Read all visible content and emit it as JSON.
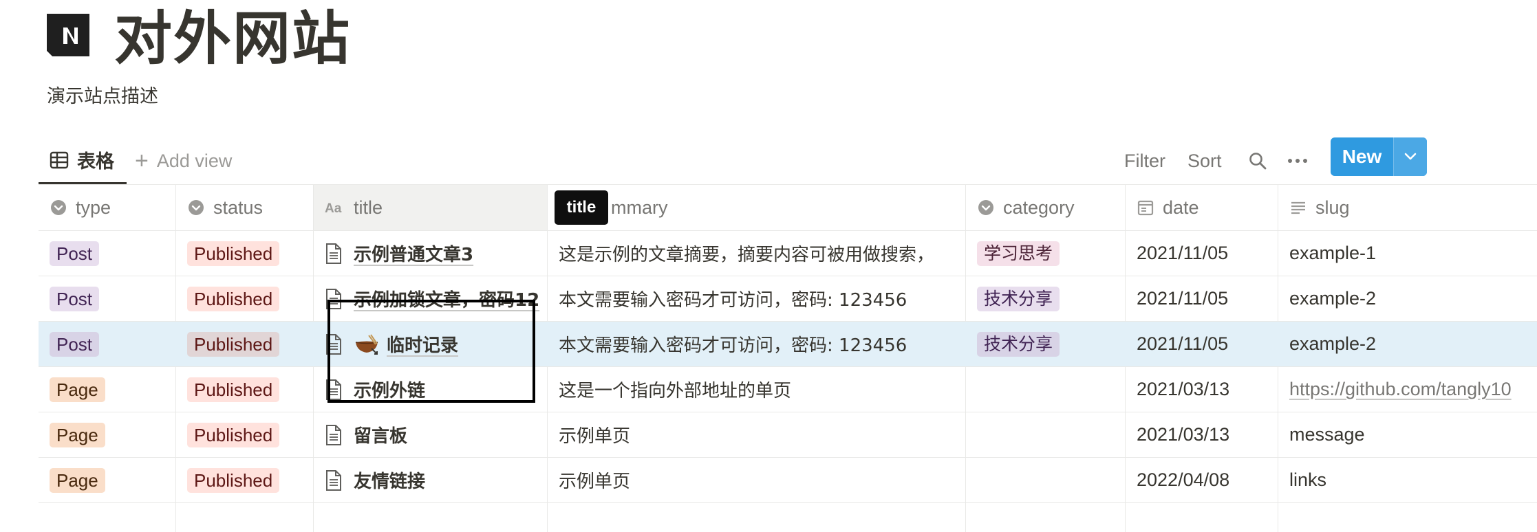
{
  "page": {
    "title": "对外网站",
    "description": "演示站点描述",
    "icon": "notion-logo-icon"
  },
  "view_bar": {
    "active_view": "表格",
    "add_view": "Add view",
    "filter": "Filter",
    "sort": "Sort",
    "new": "New"
  },
  "columns": {
    "type": "type",
    "status": "status",
    "title": "title",
    "summary": "mmary",
    "category": "category",
    "date": "date",
    "slug": "slug"
  },
  "tooltip": "title",
  "rows": [
    {
      "type": "Post",
      "status": "Published",
      "title": "示例普通文章3",
      "summary": "这是示例的文章摘要，摘要内容可被用做搜索，",
      "category": "学习思考",
      "date": "2021/11/05",
      "slug": "example-1"
    },
    {
      "type": "Post",
      "status": "Published",
      "title": "示例加锁文章，密码12",
      "summary": "本文需要输入密码才可访问，密码: 123456",
      "category": "技术分享",
      "date": "2021/11/05",
      "slug": "example-2"
    },
    {
      "type": "Post",
      "status": "Published",
      "title": "临时记录",
      "summary": "本文需要输入密码才可访问，密码: 123456",
      "category": "技术分享",
      "date": "2021/11/05",
      "slug": "example-2"
    },
    {
      "type": "Page",
      "status": "Published",
      "title": "示例外链",
      "summary": "这是一个指向外部地址的单页",
      "category": "",
      "date": "2021/03/13",
      "slug": "https://github.com/tangly10"
    },
    {
      "type": "Page",
      "status": "Published",
      "title": "留言板",
      "summary": "示例单页",
      "category": "",
      "date": "2021/03/13",
      "slug": "message"
    },
    {
      "type": "Page",
      "status": "Published",
      "title": "友情链接",
      "summary": "示例单页",
      "category": "",
      "date": "2022/04/08",
      "slug": "links"
    }
  ],
  "colors": {
    "accent": "#2f9ae0",
    "selected_row": "#e2f0f8",
    "text": "#37352f",
    "muted": "#787774"
  }
}
